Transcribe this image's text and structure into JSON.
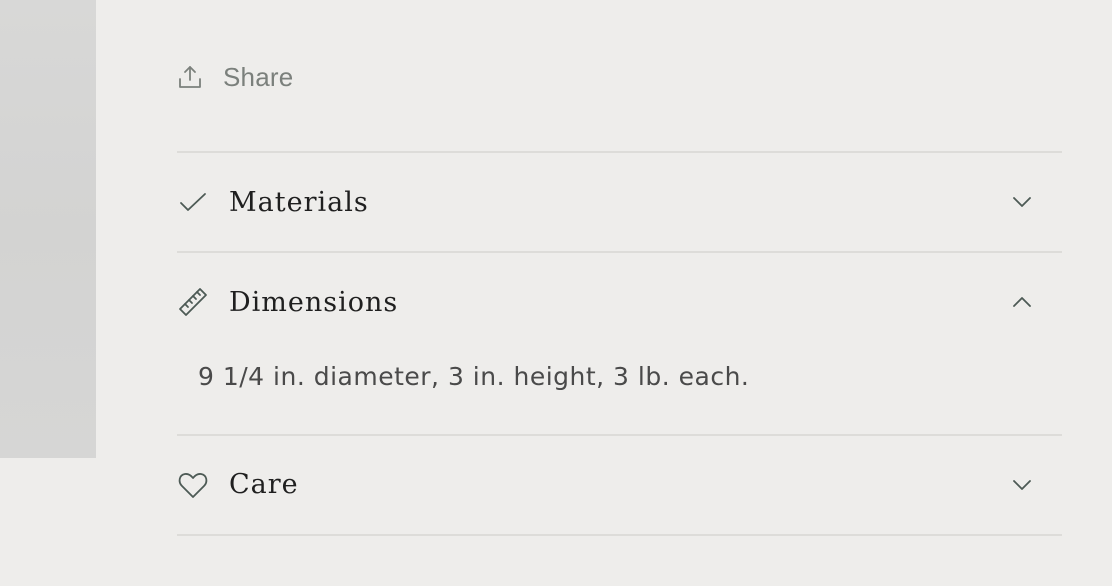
{
  "share": {
    "icon": "share-upload-icon",
    "label": "Share"
  },
  "accordion": {
    "items": [
      {
        "icon": "checkmark-icon",
        "title": "Materials",
        "expanded": false,
        "chevron": "chevron-down-icon"
      },
      {
        "icon": "ruler-icon",
        "title": "Dimensions",
        "expanded": true,
        "chevron": "chevron-up-icon",
        "content": "9 1/4 in. diameter, 3 in. height, 3 lb. each."
      },
      {
        "icon": "heart-icon",
        "title": "Care",
        "expanded": false,
        "chevron": "chevron-down-icon"
      }
    ]
  },
  "colors": {
    "background": "#eeedeb",
    "icon_stroke": "#4d5a55",
    "divider": "#dddcd9",
    "share_text": "#7b807c",
    "title_text": "#1f1f1f",
    "content_text": "#4a4a4a"
  }
}
